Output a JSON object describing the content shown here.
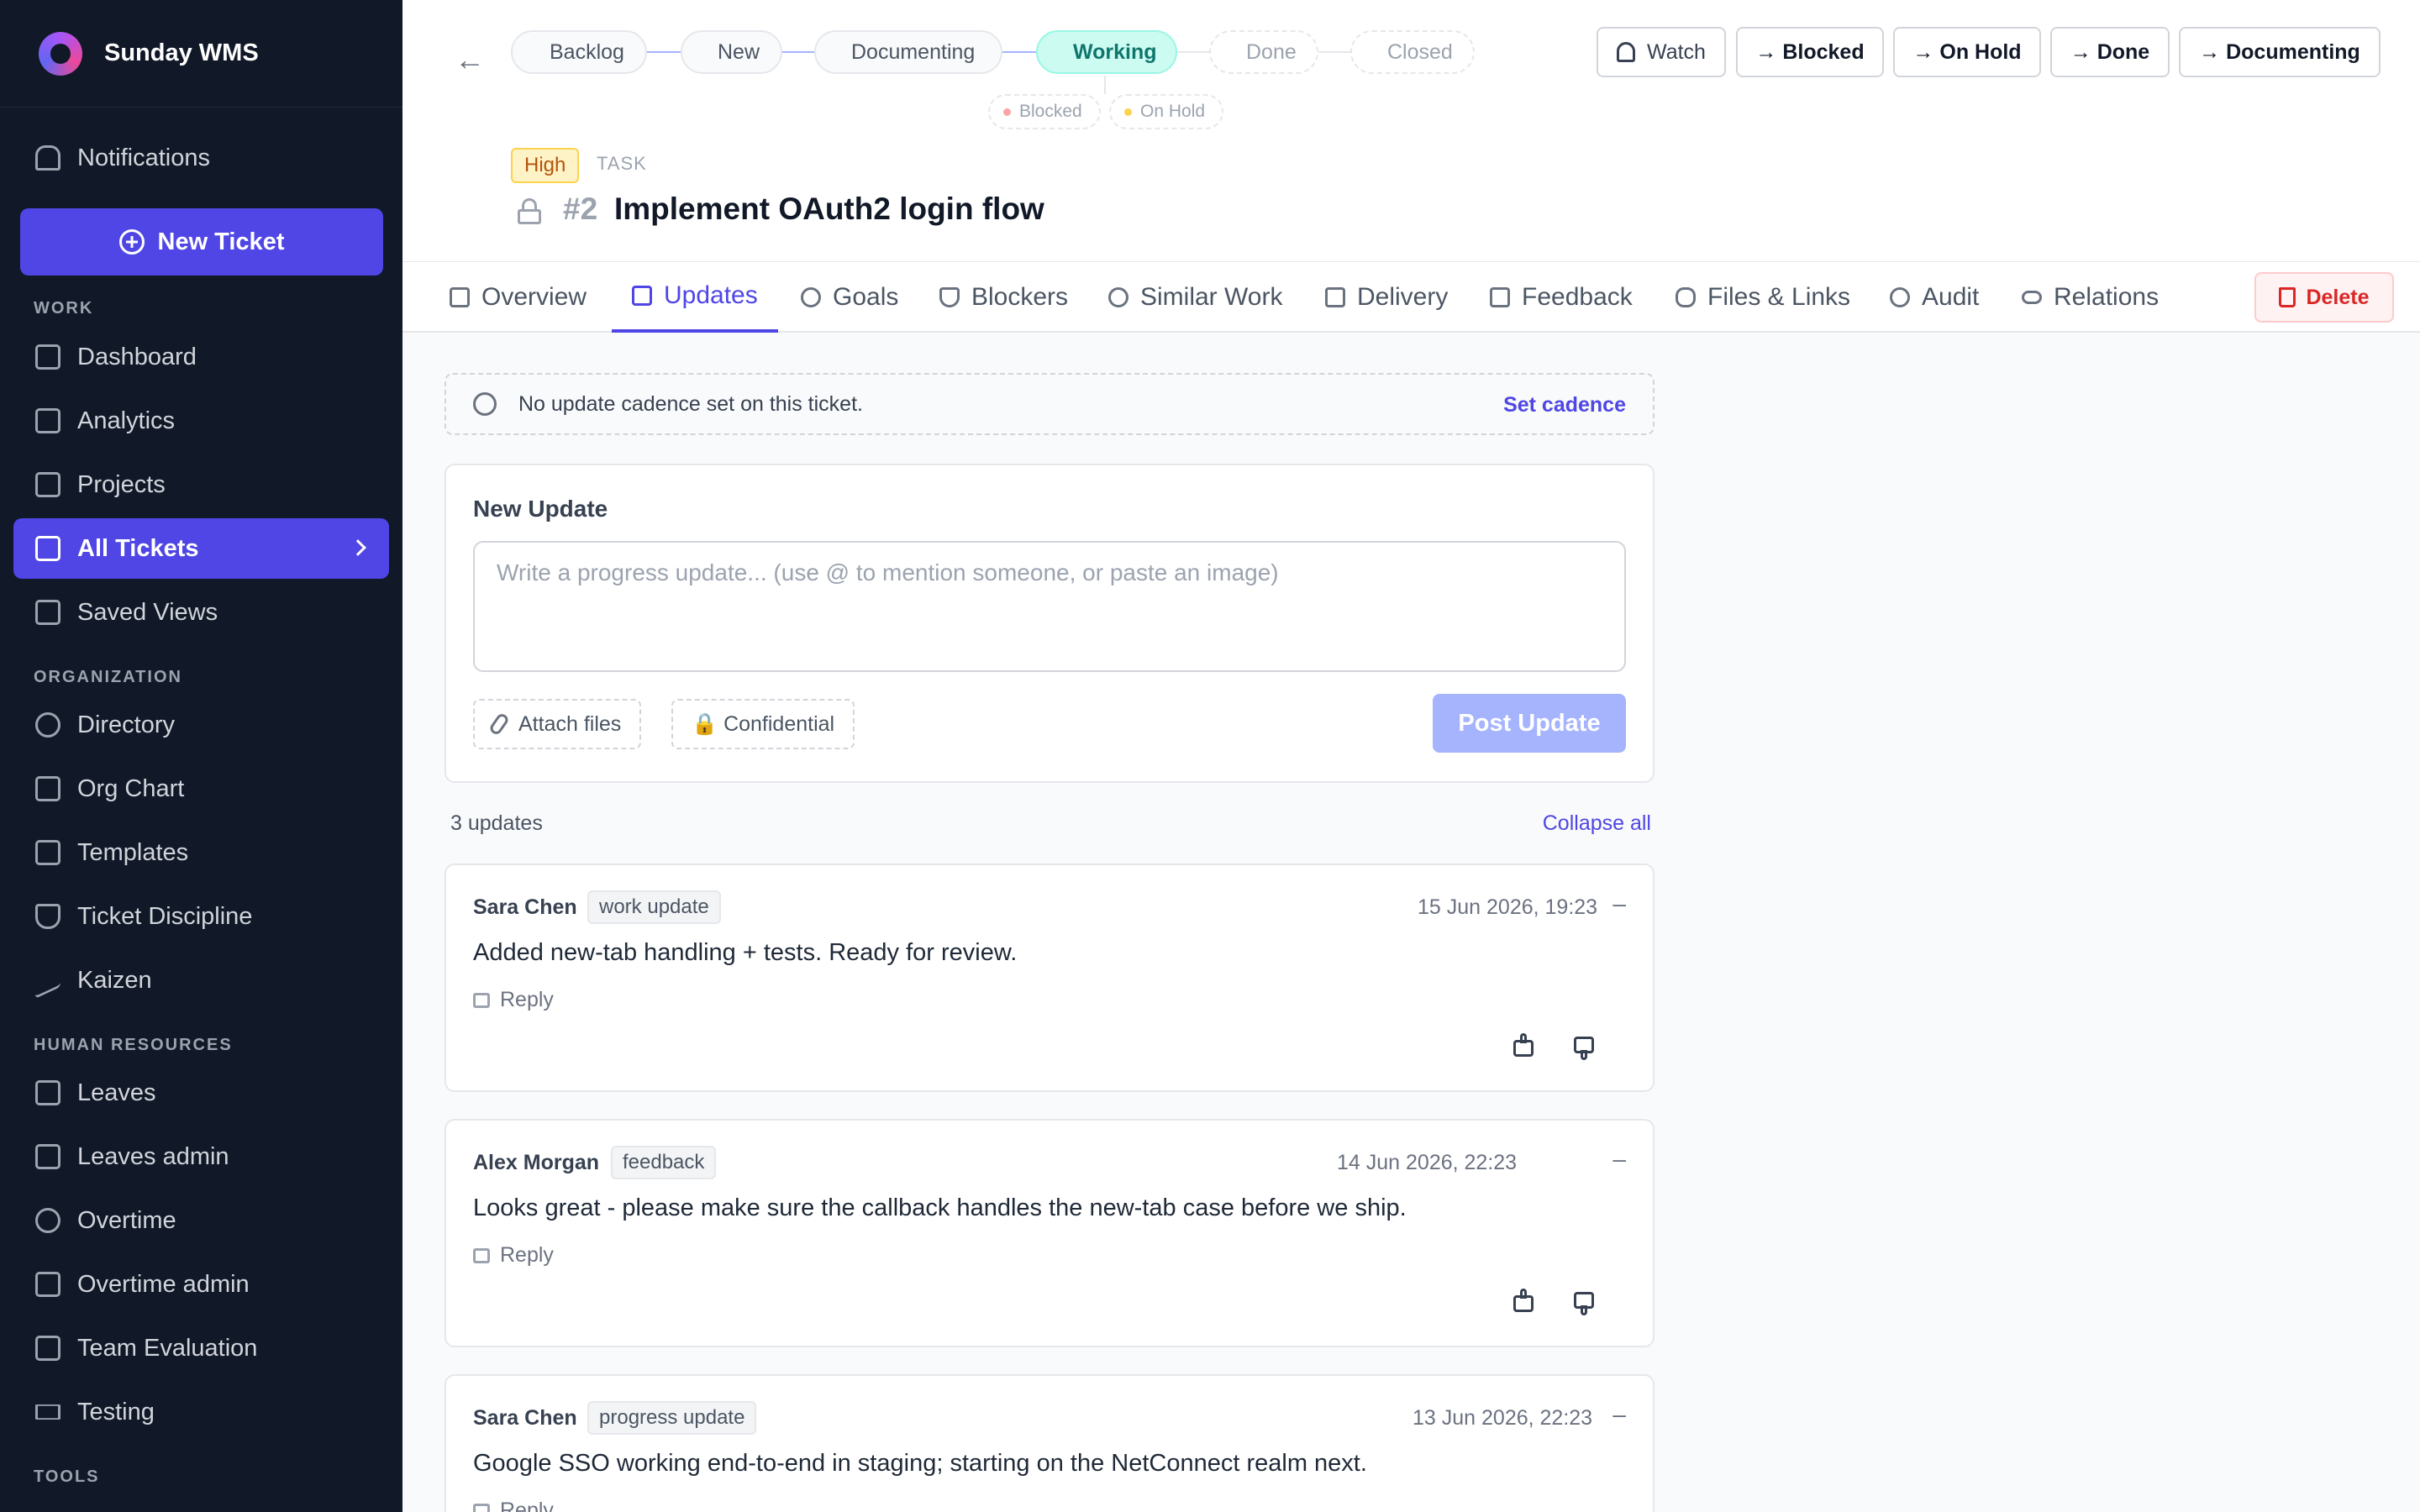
{
  "app": {
    "name": "Sunday WMS"
  },
  "sidebar": {
    "notifications": "Notifications",
    "new_ticket": "New Ticket",
    "sections": {
      "work": "WORK",
      "organization": "ORGANIZATION",
      "hr": "HUMAN RESOURCES",
      "tools": "TOOLS"
    },
    "work_items": [
      "Dashboard",
      "Analytics",
      "Projects",
      "All Tickets",
      "Saved Views"
    ],
    "org_items": [
      "Directory",
      "Org Chart",
      "Templates",
      "Ticket Discipline",
      "Kaizen"
    ],
    "hr_items": [
      "Leaves",
      "Leaves admin",
      "Overtime",
      "Overtime admin",
      "Team Evaluation",
      "Testing"
    ],
    "active_item": "All Tickets"
  },
  "workflow": {
    "stages": [
      "Backlog",
      "New",
      "Documenting",
      "Working",
      "Done",
      "Closed"
    ],
    "current": "Working",
    "side_states": [
      "Blocked",
      "On Hold"
    ]
  },
  "actions": {
    "watch": "Watch",
    "to_blocked": "→ Blocked",
    "to_on_hold": "→ On Hold",
    "to_done": "→ Done",
    "to_documenting": "→ Documenting"
  },
  "ticket": {
    "priority": "High",
    "type": "TASK",
    "number": "#2",
    "title": "Implement OAuth2 login flow"
  },
  "tabs": [
    "Overview",
    "Updates",
    "Goals",
    "Blockers",
    "Similar Work",
    "Delivery",
    "Feedback",
    "Files & Links",
    "Audit",
    "Relations"
  ],
  "active_tab": "Updates",
  "delete_label": "Delete",
  "cadence": {
    "message": "No update cadence set on this ticket.",
    "action": "Set cadence"
  },
  "new_update": {
    "title": "New Update",
    "placeholder": "Write a progress update... (use @ to mention someone, or paste an image)",
    "attach": "Attach files",
    "confidential": "🔒 Confidential",
    "post": "Post Update"
  },
  "updates_summary": {
    "count": "3 updates",
    "collapse": "Collapse all"
  },
  "updates": [
    {
      "author": "Sara Chen",
      "tag": "work update",
      "time": "15 Jun 2026, 19:23",
      "collapse": "–",
      "body": "Added new-tab handling + tests. Ready for review.",
      "reply": "Reply"
    },
    {
      "author": "Alex Morgan",
      "tag": "feedback",
      "time": "14 Jun 2026, 22:23",
      "collapse": "–",
      "body": "Looks great - please make sure the callback handles the new-tab case before we ship.",
      "reply": "Reply"
    },
    {
      "author": "Sara Chen",
      "tag": "progress update",
      "time": "13 Jun 2026, 22:23",
      "collapse": "–",
      "body": "Google SSO working end-to-end in staging; starting on the NetConnect realm next.",
      "reply": "Reply"
    }
  ],
  "colors": {
    "sidebar_bg": "#111827",
    "accent": "#4f46e5",
    "current_stage": "#0d9488",
    "danger": "#dc2626"
  }
}
